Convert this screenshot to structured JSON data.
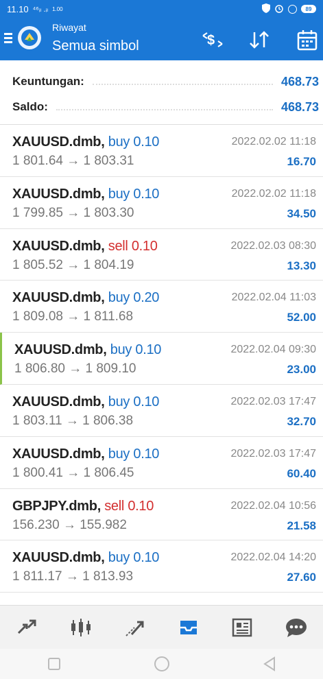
{
  "status_bar": {
    "time": "11.10",
    "signal_text": "⁴⁶ᵢₗ .ᵢₗ",
    "speed": "1.00",
    "battery": "89"
  },
  "app_bar": {
    "subtitle": "Riwayat",
    "title": "Semua simbol",
    "icons": [
      "menu-icon",
      "app-logo-icon",
      "currency-swap-icon",
      "sort-icon",
      "calendar-icon"
    ]
  },
  "summary": {
    "profit_label": "Keuntungan:",
    "profit_value": "468.73",
    "balance_label": "Saldo:",
    "balance_value": "468.73"
  },
  "trades": [
    {
      "symbol": "XAUUSD.dmb,",
      "type": "buy",
      "lot": "0.10",
      "prices": "1 801.64 → 1 803.31",
      "datetime": "2022.02.02 11:18",
      "profit": "16.70"
    },
    {
      "symbol": "XAUUSD.dmb,",
      "type": "buy",
      "lot": "0.10",
      "prices": "1 799.85 → 1 803.30",
      "datetime": "2022.02.02 11:18",
      "profit": "34.50"
    },
    {
      "symbol": "XAUUSD.dmb,",
      "type": "sell",
      "lot": "0.10",
      "prices": "1 805.52 → 1 804.19",
      "datetime": "2022.02.03 08:30",
      "profit": "13.30"
    },
    {
      "symbol": "XAUUSD.dmb,",
      "type": "buy",
      "lot": "0.20",
      "prices": "1 809.08 → 1 811.68",
      "datetime": "2022.02.04 11:03",
      "profit": "52.00"
    },
    {
      "symbol": "XAUUSD.dmb,",
      "type": "buy",
      "lot": "0.10",
      "prices": "1 806.80 → 1 809.10",
      "datetime": "2022.02.04 09:30",
      "profit": "23.00"
    },
    {
      "symbol": "XAUUSD.dmb,",
      "type": "buy",
      "lot": "0.10",
      "prices": "1 803.11 → 1 806.38",
      "datetime": "2022.02.03 17:47",
      "profit": "32.70"
    },
    {
      "symbol": "XAUUSD.dmb,",
      "type": "buy",
      "lot": "0.10",
      "prices": "1 800.41 → 1 806.45",
      "datetime": "2022.02.03 17:47",
      "profit": "60.40"
    },
    {
      "symbol": "GBPJPY.dmb,",
      "type": "sell",
      "lot": "0.10",
      "prices": "156.230 → 155.982",
      "datetime": "2022.02.04 10:56",
      "profit": "21.58"
    },
    {
      "symbol": "XAUUSD.dmb,",
      "type": "buy",
      "lot": "0.10",
      "prices": "1 811.17 → 1 813.93",
      "datetime": "2022.02.04 14:20",
      "profit": "27.60"
    }
  ],
  "bottom_nav": [
    "quotes-icon",
    "chart-icon",
    "trade-icon",
    "history-icon",
    "news-icon",
    "chat-icon"
  ],
  "colors": {
    "accent": "#1b78d6",
    "buy": "#1b6fc4",
    "sell": "#d32f2f"
  }
}
